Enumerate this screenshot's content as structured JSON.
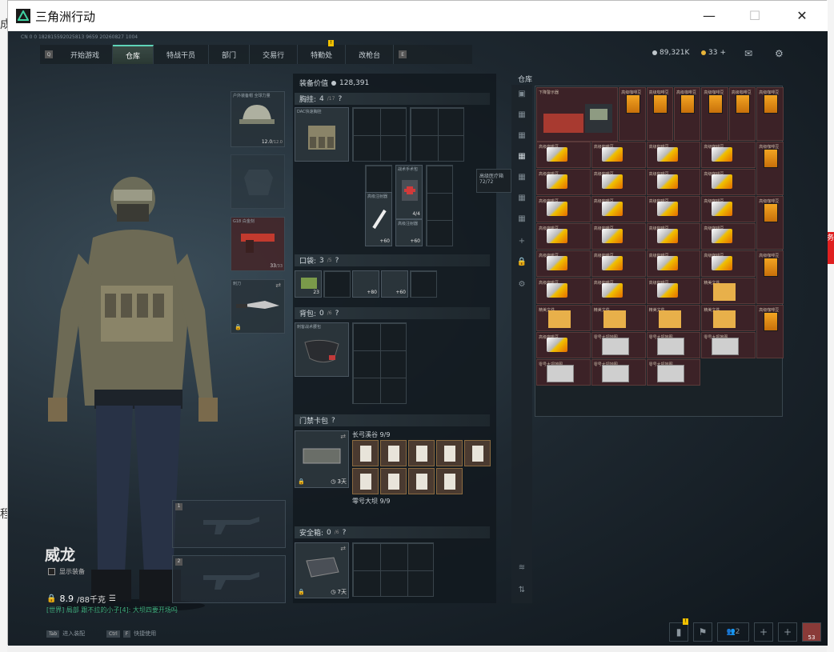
{
  "window": {
    "title": "三角洲行动",
    "minimize": "—",
    "maximize": "☐",
    "close": "✕"
  },
  "bg_text": {
    "left_top": "成",
    "left_bot": "程",
    "right_mid": "务"
  },
  "header": {
    "session_id": "CN 0 0 182815592025813 9659 20260827 1004",
    "key_left": "Q",
    "key_right": "E",
    "tabs": [
      {
        "label": "开始游戏"
      },
      {
        "label": "仓库"
      },
      {
        "label": "特战干员"
      },
      {
        "label": "部门"
      },
      {
        "label": "交易行"
      },
      {
        "label": "特勤处",
        "badge": "!"
      },
      {
        "label": "改枪台"
      }
    ],
    "currency1": "89,321K",
    "currency2": "33",
    "currency2_plus": "+"
  },
  "character": {
    "name": "威龙",
    "show_equip": "显示装备",
    "weight": "8.9",
    "weight_max": "/88千克",
    "chat": "[世界] 局部 跟不拉的小子[4]: 大坝四要开场吗",
    "footer_tab": "Tab",
    "footer_tab_label": "进入装配",
    "footer_ctrl": "Ctrl",
    "footer_f": "F",
    "footer_ctrl_label": "快捷使用"
  },
  "equip": {
    "helmet_label": "户外装备帽 全球力量",
    "helmet_value": "12.0",
    "helmet_max": "/12.0",
    "pistol_label": "G18 白金刻",
    "pistol_value": "33",
    "pistol_max": "/33",
    "knife_label": "刺刀",
    "weapon1": "1",
    "weapon2": "2"
  },
  "loadout": {
    "equip_value_label": "装备价值",
    "equip_value": "128,391",
    "chest_label": "胸挂:",
    "chest_count": "4",
    "chest_max": "/17",
    "chest_item": "DAC快速胸挂",
    "item_a": "高级注射器",
    "item_a_val": "+60",
    "item_b": "战术手术包",
    "item_b_val": "4/4",
    "item_c": "高级注射器",
    "item_c_val": "+60",
    "tooltip_name": "高级医疗箱",
    "tooltip_val": "72/72",
    "pocket_label": "口袋:",
    "pocket_count": "3",
    "pocket_max": "/5",
    "pocket_item1_val": "23",
    "pocket_item2_val": "+80",
    "pocket_item3_val": "+60",
    "backpack_label": "背包:",
    "backpack_count": "0",
    "backpack_max": "/6",
    "backpack_item": "刺客战术腰包",
    "card_label": "门禁卡包",
    "card_loc1": "长弓溪谷",
    "card_loc1_val": "9/9",
    "card_loc2": "零号大坝",
    "card_loc2_val": "9/9",
    "card_time": "3天",
    "safe_label": "安全箱:",
    "safe_count": "0",
    "safe_max": "/6",
    "safe_time": "7天"
  },
  "stash": {
    "label": "仓库",
    "first_item": "下降警示器",
    "gold_item": "高级咖啡豆",
    "silver_item": "高级咖啡豆",
    "paper_item": "精美文件",
    "map_item": "零号大坝地图"
  },
  "bottom": {
    "badge": "!",
    "friends": "2",
    "avatar_level": "53"
  }
}
